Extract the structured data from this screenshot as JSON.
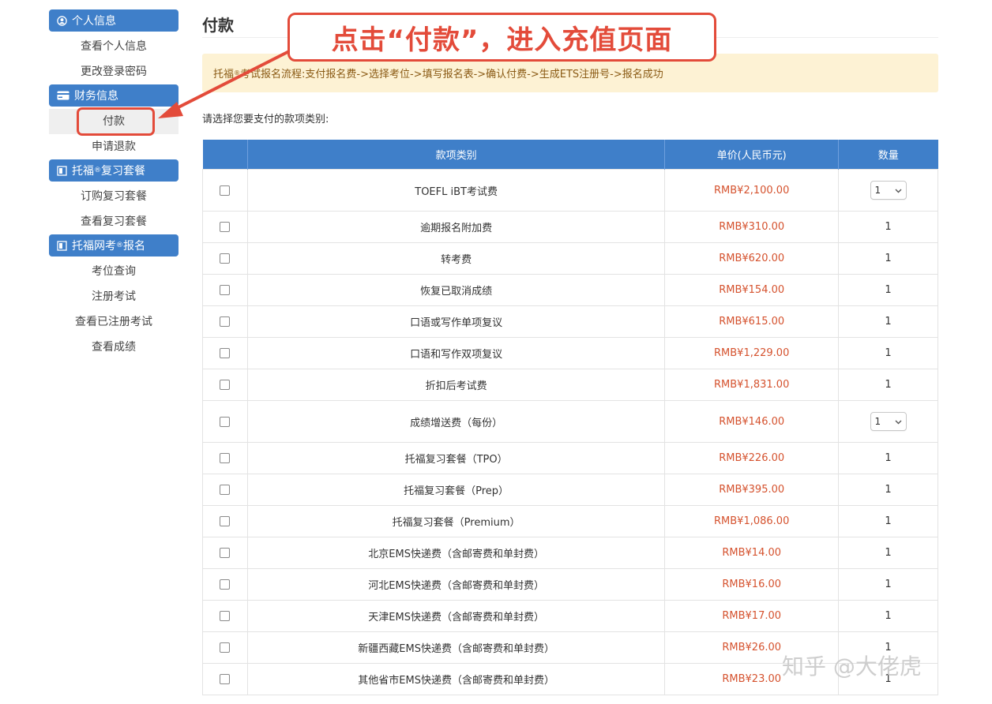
{
  "sidebar": {
    "sections": [
      {
        "title": "个人信息",
        "title_sup": "",
        "title_suffix": "",
        "items": [
          "查看个人信息",
          "更改登录密码"
        ]
      },
      {
        "title": "财务信息",
        "title_sup": "",
        "title_suffix": "",
        "items": [
          "付款",
          "申请退款"
        ]
      },
      {
        "title": "托福",
        "title_sup": "®",
        "title_suffix": "复习套餐",
        "items": [
          "订购复习套餐",
          "查看复习套餐"
        ]
      },
      {
        "title": "托福网考",
        "title_sup": "®",
        "title_suffix": "报名",
        "items": [
          "考位查询",
          "注册考试",
          "查看已注册考试",
          "查看成绩"
        ]
      }
    ],
    "active_item": "付款"
  },
  "main": {
    "page_title": "付款",
    "flow_prefix": "托福",
    "flow_sup": "®",
    "flow_text": "考试报名流程:支付报名费->选择考位->填写报名表->确认付费->生成ETS注册号->报名成功",
    "prompt": "请选择您要支付的款项类别:"
  },
  "table": {
    "headers": [
      "",
      "款项类别",
      "单价(人民币元)",
      "数量"
    ],
    "rows": [
      {
        "name": "TOEFL iBT考试费",
        "price": "RMB¥2,100.00",
        "qty": "1",
        "qty_select": true
      },
      {
        "name": "逾期报名附加费",
        "price": "RMB¥310.00",
        "qty": "1",
        "qty_select": false
      },
      {
        "name": "转考费",
        "price": "RMB¥620.00",
        "qty": "1",
        "qty_select": false
      },
      {
        "name": "恢复已取消成绩",
        "price": "RMB¥154.00",
        "qty": "1",
        "qty_select": false
      },
      {
        "name": "口语或写作单项复议",
        "price": "RMB¥615.00",
        "qty": "1",
        "qty_select": false
      },
      {
        "name": "口语和写作双项复议",
        "price": "RMB¥1,229.00",
        "qty": "1",
        "qty_select": false
      },
      {
        "name": "折扣后考试费",
        "price": "RMB¥1,831.00",
        "qty": "1",
        "qty_select": false
      },
      {
        "name": "成绩增送费（每份）",
        "price": "RMB¥146.00",
        "qty": "1",
        "qty_select": true
      },
      {
        "name": "托福复习套餐（TPO）",
        "price": "RMB¥226.00",
        "qty": "1",
        "qty_select": false
      },
      {
        "name": "托福复习套餐（Prep）",
        "price": "RMB¥395.00",
        "qty": "1",
        "qty_select": false
      },
      {
        "name": "托福复习套餐（Premium）",
        "price": "RMB¥1,086.00",
        "qty": "1",
        "qty_select": false
      },
      {
        "name": "北京EMS快递费（含邮寄费和单封费）",
        "price": "RMB¥14.00",
        "qty": "1",
        "qty_select": false
      },
      {
        "name": "河北EMS快递费（含邮寄费和单封费）",
        "price": "RMB¥16.00",
        "qty": "1",
        "qty_select": false
      },
      {
        "name": "天津EMS快递费（含邮寄费和单封费）",
        "price": "RMB¥17.00",
        "qty": "1",
        "qty_select": false
      },
      {
        "name": "新疆西藏EMS快递费（含邮寄费和单封费）",
        "price": "RMB¥26.00",
        "qty": "1",
        "qty_select": false
      },
      {
        "name": "其他省市EMS快递费（含邮寄费和单封费）",
        "price": "RMB¥23.00",
        "qty": "1",
        "qty_select": false
      }
    ]
  },
  "annotation": {
    "text": "点击“付款”，进入充值页面",
    "color": "#e34b3a"
  },
  "watermark": "知乎 @大佬虎",
  "colors": {
    "accent": "#3f7fc9",
    "price": "#d5522e",
    "notice_bg": "#fdf2d4"
  },
  "icons": {
    "section_icons": [
      "user-circle-icon",
      "credit-card-icon",
      "book-icon",
      "book-icon"
    ]
  }
}
